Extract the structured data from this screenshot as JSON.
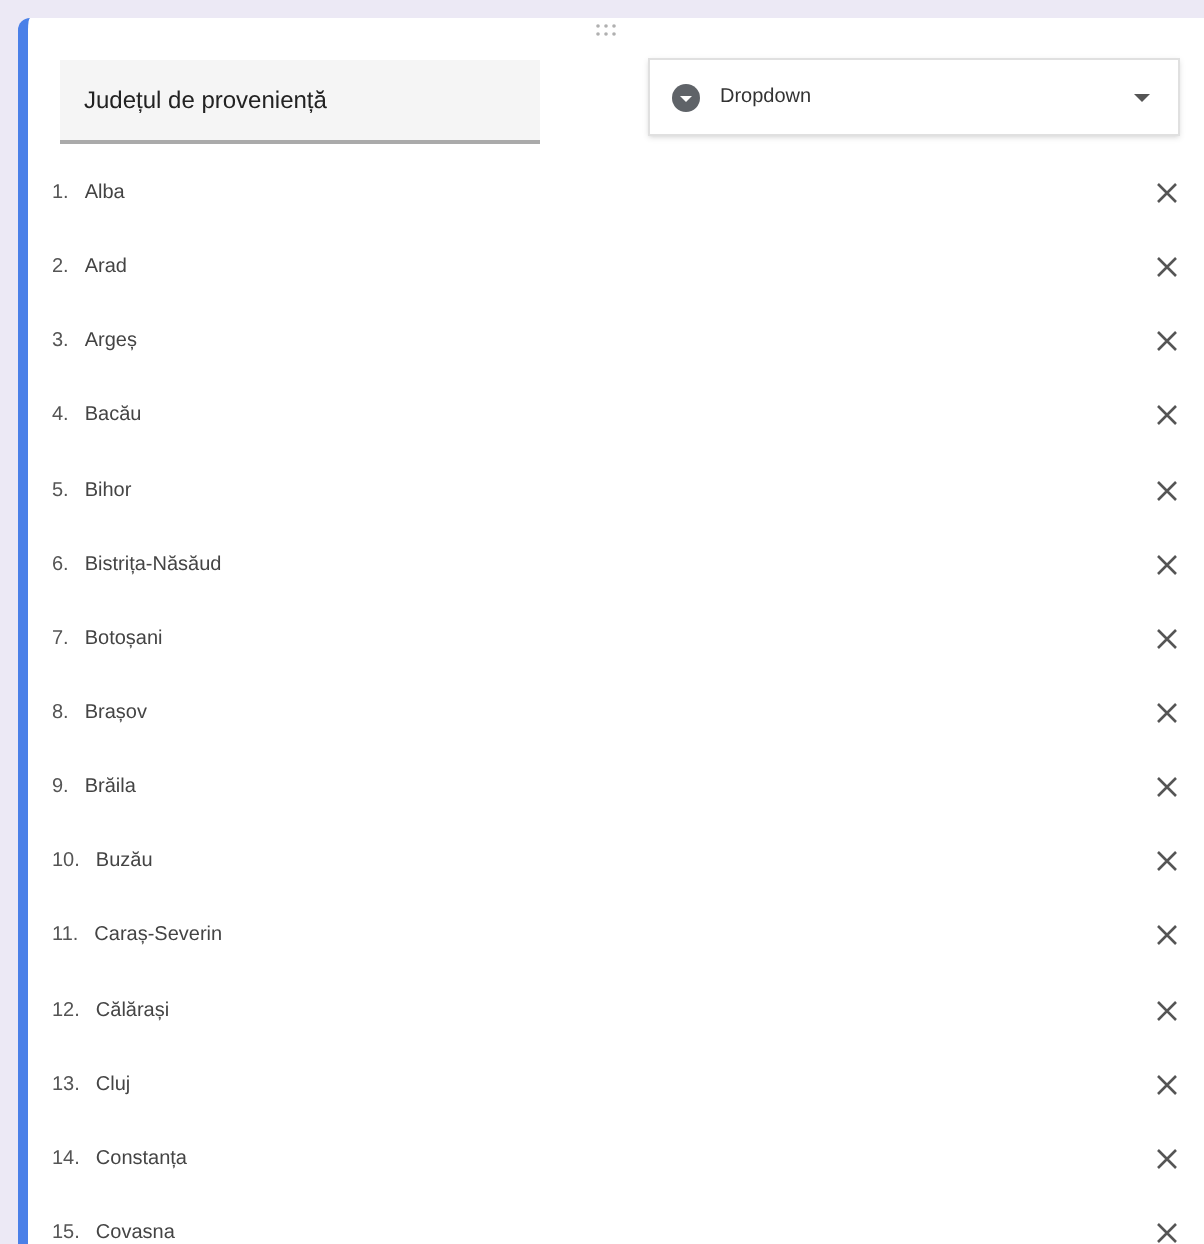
{
  "question": {
    "title": "Județul de proveniență"
  },
  "type_select": {
    "label": "Dropdown"
  },
  "options": [
    {
      "number": "1.",
      "label": "Alba"
    },
    {
      "number": "2.",
      "label": "Arad"
    },
    {
      "number": "3.",
      "label": "Argeș"
    },
    {
      "number": "4.",
      "label": "Bacău"
    },
    {
      "number": "5.",
      "label": "Bihor"
    },
    {
      "number": "6.",
      "label": "Bistrița-Năsăud"
    },
    {
      "number": "7.",
      "label": "Botoșani"
    },
    {
      "number": "8.",
      "label": "Brașov"
    },
    {
      "number": "9.",
      "label": "Brăila"
    },
    {
      "number": "10.",
      "label": "Buzău"
    },
    {
      "number": "11.",
      "label": "Caraș-Severin"
    },
    {
      "number": "12.",
      "label": "Călărași"
    },
    {
      "number": "13.",
      "label": "Cluj"
    },
    {
      "number": "14.",
      "label": "Constanța"
    },
    {
      "number": "15.",
      "label": "Covasna"
    }
  ]
}
